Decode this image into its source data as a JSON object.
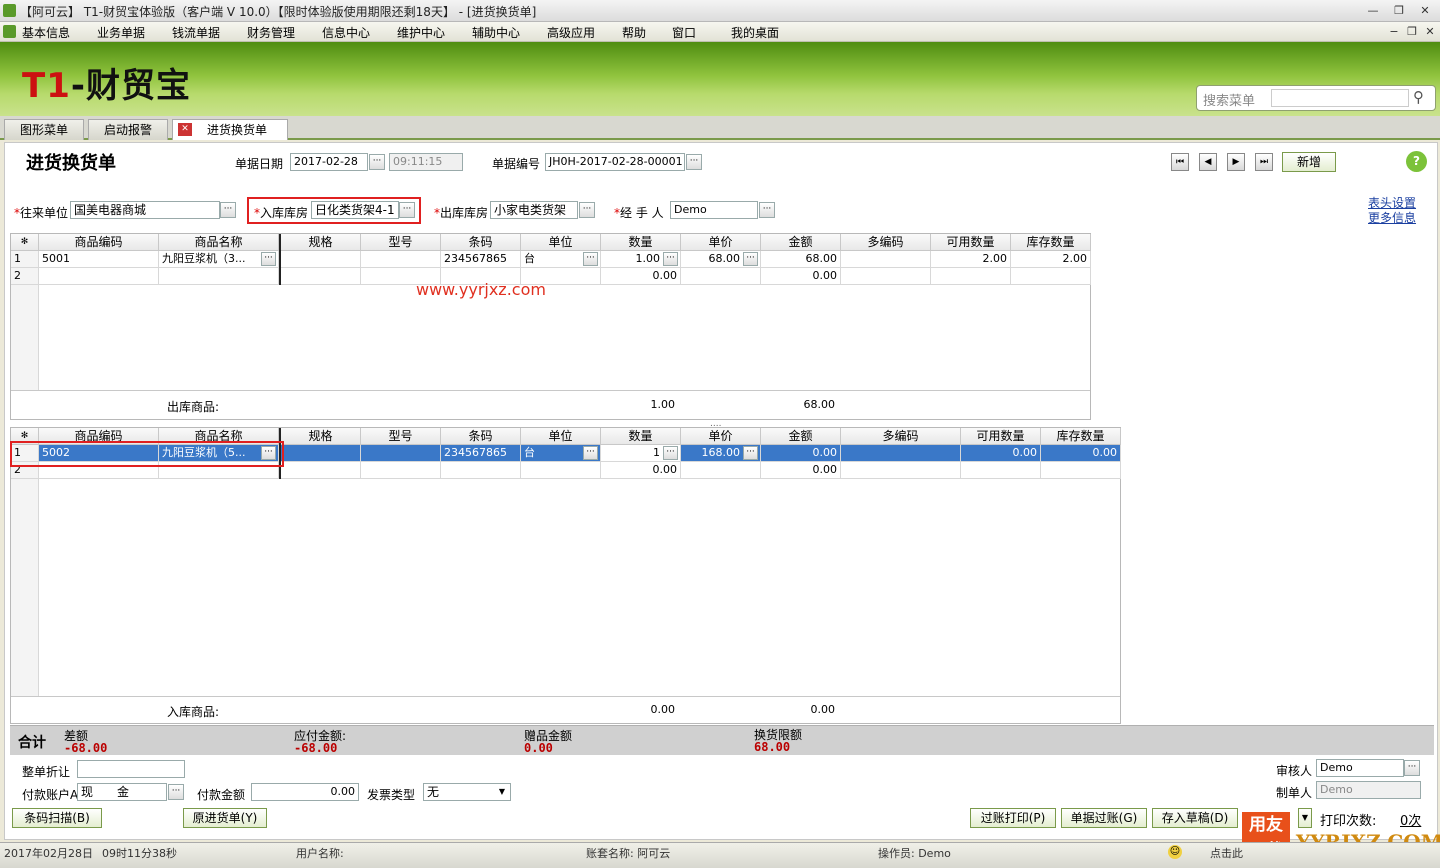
{
  "window": {
    "title": "【阿可云】 T1-财贸宝体验版（客户端 V 10.0）【限时体验版使用期限还剩18天】 - [进货换货单]"
  },
  "menu": [
    "基本信息",
    "业务单据",
    "钱流单据",
    "财务管理",
    "信息中心",
    "维护中心",
    "辅助中心",
    "高级应用",
    "帮助",
    "窗口",
    "我的桌面"
  ],
  "brand": {
    "t1": "T1",
    "rest": "-财贸宝"
  },
  "search": {
    "label": "搜索菜单"
  },
  "tabs": [
    "图形菜单",
    "启动报警",
    "进货换货单"
  ],
  "header": {
    "doc_title": "进货换货单",
    "date_label": "单据日期",
    "date": "2017-02-28",
    "time": "09:11:15",
    "no_label": "单据编号",
    "no": "JH0H-2017-02-28-00001",
    "new_btn": "新增"
  },
  "fields": {
    "partner_label": "往来单位",
    "partner": "国美电器商城",
    "in_wh_label": "入库库房",
    "in_wh": "日化类货架4-1",
    "out_wh_label": "出库库房",
    "out_wh": "小家电类货架",
    "handler_label": "经 手 人",
    "handler": "Demo",
    "req": "*",
    "link1": "表头设置",
    "link2": "更多信息"
  },
  "columns": [
    "商品编码",
    "商品名称",
    "规格",
    "型号",
    "条码",
    "单位",
    "数量",
    "单价",
    "金额",
    "多编码",
    "可用数量",
    "库存数量"
  ],
  "grid_out": {
    "rows": [
      {
        "no": "1",
        "code": "5001",
        "name": "九阳豆浆机（3...",
        "spec": "",
        "model": "",
        "barcode": "234567865",
        "unit": "台",
        "qty": "1.00",
        "price": "68.00",
        "amount": "68.00",
        "multi": "",
        "avail": "2.00",
        "stock": "2.00"
      },
      {
        "no": "2",
        "code": "",
        "name": "",
        "spec": "",
        "model": "",
        "barcode": "",
        "unit": "",
        "qty": "0.00",
        "price": "",
        "amount": "0.00",
        "multi": "",
        "avail": "",
        "stock": ""
      }
    ],
    "total_label": "出库商品:",
    "total_qty": "1.00",
    "total_amount": "68.00"
  },
  "grid_in": {
    "rows": [
      {
        "no": "1",
        "code": "5002",
        "name": "九阳豆浆机（5...",
        "spec": "",
        "model": "",
        "barcode": "234567865",
        "unit": "台",
        "qty": "1",
        "price": "168.00",
        "amount": "0.00",
        "multi": "",
        "avail": "0.00",
        "stock": "0.00"
      },
      {
        "no": "2",
        "code": "",
        "name": "",
        "spec": "",
        "model": "",
        "barcode": "",
        "unit": "",
        "qty": "0.00",
        "price": "",
        "amount": "0.00",
        "multi": "",
        "avail": "",
        "stock": ""
      }
    ],
    "total_label": "入库商品:",
    "total_qty": "0.00",
    "total_amount": "0.00"
  },
  "watermark": "www.yyrjxz.com",
  "summary": {
    "label": "合计",
    "diff_label": "差额",
    "diff": "-68.00",
    "payable_label": "应付金额:",
    "payable": "-68.00",
    "gift_label": "赠品金额",
    "gift": "0.00",
    "limit_label": "换货限额",
    "limit": "68.00"
  },
  "footer": {
    "discount_label": "整单折让",
    "account_label": "付款账户A",
    "account": "现　　金",
    "payamt_label": "付款金额",
    "payamt": "0.00",
    "invoice_label": "发票类型",
    "invoice": "无",
    "auditor_label": "审核人",
    "auditor": "Demo",
    "maker_label": "制单人",
    "maker": "Demo",
    "btn_scan": "条码扫描(B)",
    "btn_orig": "原进货单(Y)",
    "btn_postprint": "过账打印(P)",
    "btn_post": "单据过账(G)",
    "btn_draft": "存入草稿(D)",
    "print_label": "打印次数:",
    "print_count": "0次"
  },
  "status": {
    "date": "2017年02月28日",
    "time": "09时11分38秒",
    "user": "用户名称:",
    "book": "账套名称: 阿可云",
    "operator": "操作员: Demo",
    "click": "点击此"
  },
  "overlay_logo": {
    "a": "用友",
    "b": "下载",
    "site": "YYRJXZ.COM"
  }
}
